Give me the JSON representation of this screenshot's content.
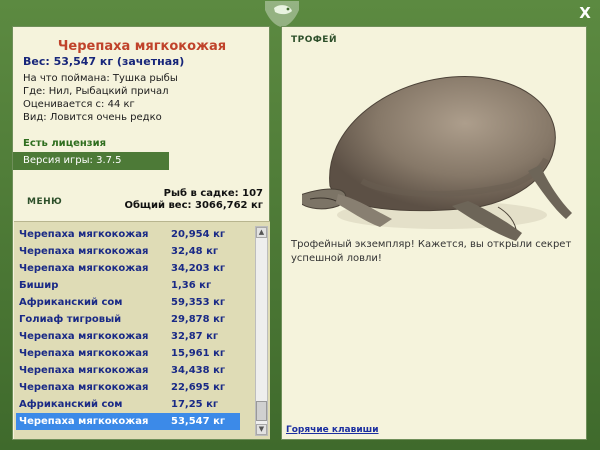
{
  "window": {
    "close_label": "X"
  },
  "fish_info": {
    "title": "Черепаха мягкокожая",
    "weight": "Вес: 53,547 кг (зачетная)",
    "bait": "На что поймана: Тушка рыбы",
    "location": "Где: Нил, Рыбацкий причал",
    "valued_from": "Оценивается с: 44 кг",
    "rarity": "Вид: Ловится очень редко"
  },
  "license": {
    "label": "Есть лицензия"
  },
  "version": {
    "label": "Версия игры: 3.7.5"
  },
  "menu": {
    "label": "МЕНЮ"
  },
  "stats": {
    "cage_count": "Рыб в садке: 107",
    "total_weight": "Общий вес: 3066,762 кг"
  },
  "catch_list": [
    {
      "name": "Черепаха мягкокожая",
      "weight": "20,954 кг"
    },
    {
      "name": "Черепаха мягкокожая",
      "weight": "32,48 кг"
    },
    {
      "name": "Черепаха мягкокожая",
      "weight": "34,203 кг"
    },
    {
      "name": "Бишир",
      "weight": "1,36 кг"
    },
    {
      "name": "Африканский сом",
      "weight": "59,353 кг"
    },
    {
      "name": "Голиаф тигровый",
      "weight": "29,878 кг"
    },
    {
      "name": "Черепаха мягкокожая",
      "weight": "32,87 кг"
    },
    {
      "name": "Черепаха мягкокожая",
      "weight": "15,961 кг"
    },
    {
      "name": "Черепаха мягкокожая",
      "weight": "34,438 кг"
    },
    {
      "name": "Черепаха мягкокожая",
      "weight": "22,695 кг"
    },
    {
      "name": "Африканский сом",
      "weight": "17,25 кг"
    },
    {
      "name": "Черепаха мягкокожая",
      "weight": "53,547 кг"
    }
  ],
  "trophy": {
    "label": "ТРОФЕЙ",
    "text": "Трофейный экземпляр! Кажется, вы открыли секрет успешной ловли!"
  },
  "hotkeys": {
    "label": "Горячие клавиши"
  },
  "colors": {
    "frame_green": "#4f7a37",
    "panel_bg": "#f5f3dc",
    "list_bg": "#dfdcb6",
    "selection_blue": "#3c8ae8",
    "title_red": "#c0432b",
    "text_navy": "#1a2a86"
  }
}
